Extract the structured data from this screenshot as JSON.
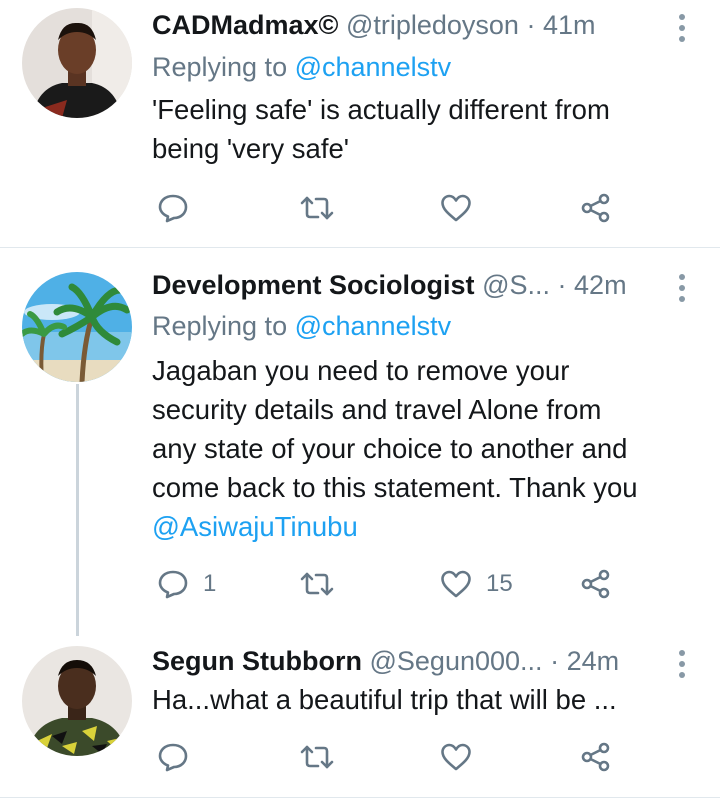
{
  "tweets": [
    {
      "name": "CADMadmax©",
      "handle": "@tripledoyson",
      "separator": "·",
      "time": "41m",
      "replying_prefix": "Replying to ",
      "replying_to": "@channelstv",
      "text_lines": [
        "'Feeling safe' is actually different from",
        "being 'very safe'"
      ],
      "actions": {
        "reply_count": "",
        "retweet_count": "",
        "like_count": ""
      }
    },
    {
      "name": "Development Sociologist",
      "handle": "@S...",
      "separator": "·",
      "time": "42m",
      "replying_prefix": "Replying to ",
      "replying_to": "@channelstv",
      "text_lines": [
        "Jagaban you need to remove your",
        "security details and travel Alone from",
        "any state of your choice to another and",
        "come back to this statement. Thank you"
      ],
      "text_mention": "@AsiwajuTinubu",
      "actions": {
        "reply_count": "1",
        "retweet_count": "",
        "like_count": "15"
      }
    },
    {
      "name": "Segun Stubborn",
      "handle": "@Segun000...",
      "separator": "·",
      "time": "24m",
      "text_lines": [
        "Ha...what a beautiful trip that will be ..."
      ],
      "actions": {
        "reply_count": "",
        "retweet_count": "",
        "like_count": ""
      }
    }
  ],
  "icons": {
    "reply": "reply-icon",
    "retweet": "retweet-icon",
    "like": "like-icon",
    "share": "share-icon",
    "more": "more-options-icon"
  },
  "colors": {
    "link": "#1da1f2",
    "secondary_text": "#657786",
    "primary_text": "#14171a",
    "divider": "#e1e8ed"
  }
}
